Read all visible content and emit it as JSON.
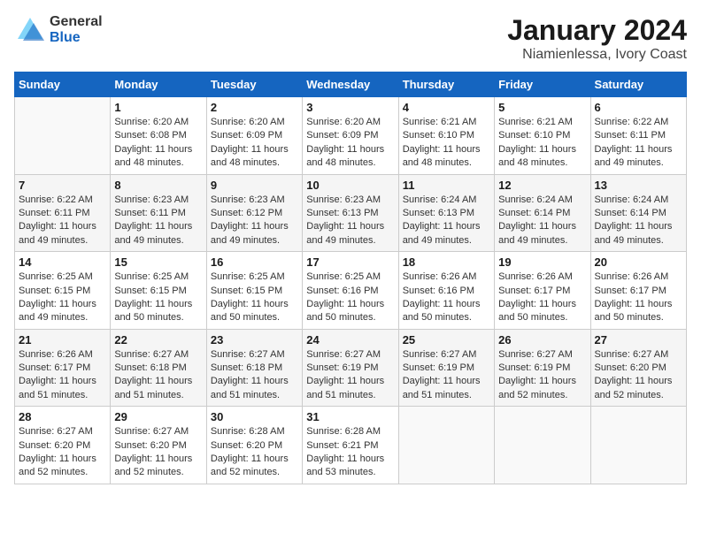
{
  "header": {
    "logo_general": "General",
    "logo_blue": "Blue",
    "title": "January 2024",
    "subtitle": "Niamienlessa, Ivory Coast"
  },
  "weekdays": [
    "Sunday",
    "Monday",
    "Tuesday",
    "Wednesday",
    "Thursday",
    "Friday",
    "Saturday"
  ],
  "weeks": [
    [
      {
        "day": "",
        "sunrise": "",
        "sunset": "",
        "daylight": ""
      },
      {
        "day": "1",
        "sunrise": "Sunrise: 6:20 AM",
        "sunset": "Sunset: 6:08 PM",
        "daylight": "Daylight: 11 hours and 48 minutes."
      },
      {
        "day": "2",
        "sunrise": "Sunrise: 6:20 AM",
        "sunset": "Sunset: 6:09 PM",
        "daylight": "Daylight: 11 hours and 48 minutes."
      },
      {
        "day": "3",
        "sunrise": "Sunrise: 6:20 AM",
        "sunset": "Sunset: 6:09 PM",
        "daylight": "Daylight: 11 hours and 48 minutes."
      },
      {
        "day": "4",
        "sunrise": "Sunrise: 6:21 AM",
        "sunset": "Sunset: 6:10 PM",
        "daylight": "Daylight: 11 hours and 48 minutes."
      },
      {
        "day": "5",
        "sunrise": "Sunrise: 6:21 AM",
        "sunset": "Sunset: 6:10 PM",
        "daylight": "Daylight: 11 hours and 48 minutes."
      },
      {
        "day": "6",
        "sunrise": "Sunrise: 6:22 AM",
        "sunset": "Sunset: 6:11 PM",
        "daylight": "Daylight: 11 hours and 49 minutes."
      }
    ],
    [
      {
        "day": "7",
        "sunrise": "Sunrise: 6:22 AM",
        "sunset": "Sunset: 6:11 PM",
        "daylight": "Daylight: 11 hours and 49 minutes."
      },
      {
        "day": "8",
        "sunrise": "Sunrise: 6:23 AM",
        "sunset": "Sunset: 6:11 PM",
        "daylight": "Daylight: 11 hours and 49 minutes."
      },
      {
        "day": "9",
        "sunrise": "Sunrise: 6:23 AM",
        "sunset": "Sunset: 6:12 PM",
        "daylight": "Daylight: 11 hours and 49 minutes."
      },
      {
        "day": "10",
        "sunrise": "Sunrise: 6:23 AM",
        "sunset": "Sunset: 6:13 PM",
        "daylight": "Daylight: 11 hours and 49 minutes."
      },
      {
        "day": "11",
        "sunrise": "Sunrise: 6:24 AM",
        "sunset": "Sunset: 6:13 PM",
        "daylight": "Daylight: 11 hours and 49 minutes."
      },
      {
        "day": "12",
        "sunrise": "Sunrise: 6:24 AM",
        "sunset": "Sunset: 6:14 PM",
        "daylight": "Daylight: 11 hours and 49 minutes."
      },
      {
        "day": "13",
        "sunrise": "Sunrise: 6:24 AM",
        "sunset": "Sunset: 6:14 PM",
        "daylight": "Daylight: 11 hours and 49 minutes."
      }
    ],
    [
      {
        "day": "14",
        "sunrise": "Sunrise: 6:25 AM",
        "sunset": "Sunset: 6:15 PM",
        "daylight": "Daylight: 11 hours and 49 minutes."
      },
      {
        "day": "15",
        "sunrise": "Sunrise: 6:25 AM",
        "sunset": "Sunset: 6:15 PM",
        "daylight": "Daylight: 11 hours and 50 minutes."
      },
      {
        "day": "16",
        "sunrise": "Sunrise: 6:25 AM",
        "sunset": "Sunset: 6:15 PM",
        "daylight": "Daylight: 11 hours and 50 minutes."
      },
      {
        "day": "17",
        "sunrise": "Sunrise: 6:25 AM",
        "sunset": "Sunset: 6:16 PM",
        "daylight": "Daylight: 11 hours and 50 minutes."
      },
      {
        "day": "18",
        "sunrise": "Sunrise: 6:26 AM",
        "sunset": "Sunset: 6:16 PM",
        "daylight": "Daylight: 11 hours and 50 minutes."
      },
      {
        "day": "19",
        "sunrise": "Sunrise: 6:26 AM",
        "sunset": "Sunset: 6:17 PM",
        "daylight": "Daylight: 11 hours and 50 minutes."
      },
      {
        "day": "20",
        "sunrise": "Sunrise: 6:26 AM",
        "sunset": "Sunset: 6:17 PM",
        "daylight": "Daylight: 11 hours and 50 minutes."
      }
    ],
    [
      {
        "day": "21",
        "sunrise": "Sunrise: 6:26 AM",
        "sunset": "Sunset: 6:17 PM",
        "daylight": "Daylight: 11 hours and 51 minutes."
      },
      {
        "day": "22",
        "sunrise": "Sunrise: 6:27 AM",
        "sunset": "Sunset: 6:18 PM",
        "daylight": "Daylight: 11 hours and 51 minutes."
      },
      {
        "day": "23",
        "sunrise": "Sunrise: 6:27 AM",
        "sunset": "Sunset: 6:18 PM",
        "daylight": "Daylight: 11 hours and 51 minutes."
      },
      {
        "day": "24",
        "sunrise": "Sunrise: 6:27 AM",
        "sunset": "Sunset: 6:19 PM",
        "daylight": "Daylight: 11 hours and 51 minutes."
      },
      {
        "day": "25",
        "sunrise": "Sunrise: 6:27 AM",
        "sunset": "Sunset: 6:19 PM",
        "daylight": "Daylight: 11 hours and 51 minutes."
      },
      {
        "day": "26",
        "sunrise": "Sunrise: 6:27 AM",
        "sunset": "Sunset: 6:19 PM",
        "daylight": "Daylight: 11 hours and 52 minutes."
      },
      {
        "day": "27",
        "sunrise": "Sunrise: 6:27 AM",
        "sunset": "Sunset: 6:20 PM",
        "daylight": "Daylight: 11 hours and 52 minutes."
      }
    ],
    [
      {
        "day": "28",
        "sunrise": "Sunrise: 6:27 AM",
        "sunset": "Sunset: 6:20 PM",
        "daylight": "Daylight: 11 hours and 52 minutes."
      },
      {
        "day": "29",
        "sunrise": "Sunrise: 6:27 AM",
        "sunset": "Sunset: 6:20 PM",
        "daylight": "Daylight: 11 hours and 52 minutes."
      },
      {
        "day": "30",
        "sunrise": "Sunrise: 6:28 AM",
        "sunset": "Sunset: 6:20 PM",
        "daylight": "Daylight: 11 hours and 52 minutes."
      },
      {
        "day": "31",
        "sunrise": "Sunrise: 6:28 AM",
        "sunset": "Sunset: 6:21 PM",
        "daylight": "Daylight: 11 hours and 53 minutes."
      },
      {
        "day": "",
        "sunrise": "",
        "sunset": "",
        "daylight": ""
      },
      {
        "day": "",
        "sunrise": "",
        "sunset": "",
        "daylight": ""
      },
      {
        "day": "",
        "sunrise": "",
        "sunset": "",
        "daylight": ""
      }
    ]
  ]
}
